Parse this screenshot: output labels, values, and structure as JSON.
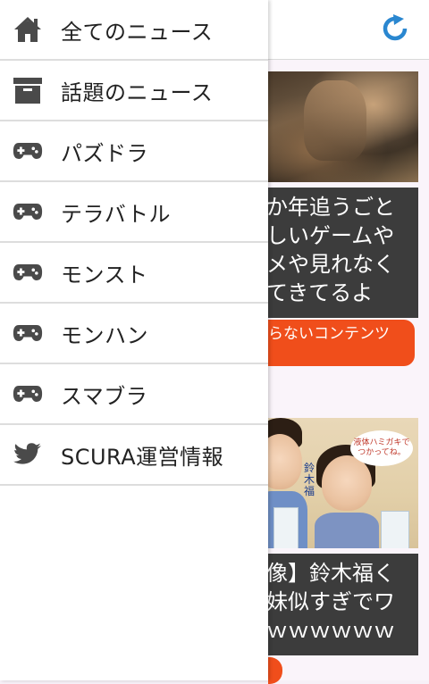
{
  "colors": {
    "accent": "#2a87d0",
    "icon_gray": "#4a4a4a",
    "caption_bg": "#3c3c3c",
    "button_orange": "#f04e1b"
  },
  "header": {
    "refresh_icon": "refresh-icon"
  },
  "drawer": {
    "items": [
      {
        "label": "全てのニュース",
        "icon": "home-icon"
      },
      {
        "label": "話題のニュース",
        "icon": "archive-icon"
      },
      {
        "label": "パズドラ",
        "icon": "gamepad-icon"
      },
      {
        "label": "テラバトル",
        "icon": "gamepad-icon"
      },
      {
        "label": "モンスト",
        "icon": "gamepad-icon"
      },
      {
        "label": "モンハン",
        "icon": "gamepad-icon"
      },
      {
        "label": "スマブラ",
        "icon": "gamepad-icon"
      },
      {
        "label": "SCURA運営情報",
        "icon": "twitter-icon"
      }
    ]
  },
  "feed": {
    "article_1": {
      "caption_lines": [
        "か年追うごと",
        "しいゲームや",
        "メや見れなく",
        "てきてるよ"
      ],
      "button_label": "らないコンテンツ"
    },
    "article_2": {
      "image_text": "液体ハミガキで つかってね。",
      "image_label": "鈴木福",
      "caption_lines": [
        "像】鈴木福く",
        "妹似すぎでワ",
        "ｗｗｗｗｗｗ"
      ]
    }
  }
}
